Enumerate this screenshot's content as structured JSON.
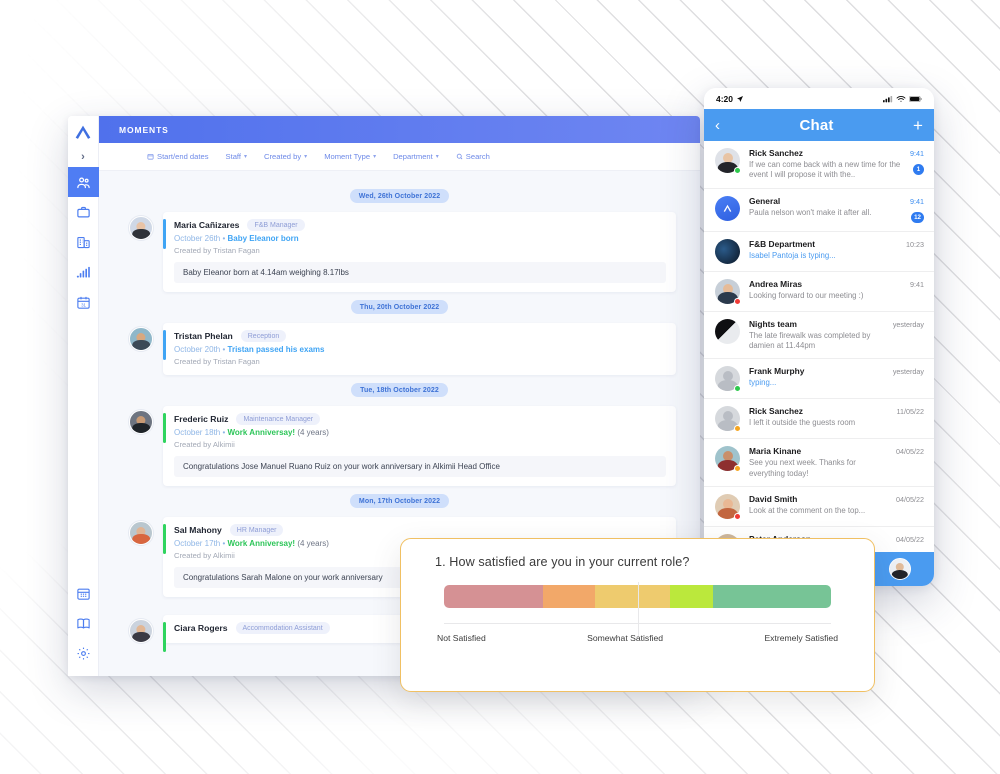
{
  "desktop": {
    "titlebar": {
      "title": "MOMENTS"
    },
    "rail": {
      "logo_icon": "alkimii-logo-icon",
      "expand_icon": "chevron-right-icon",
      "items": [
        {
          "name": "people",
          "icon": "people-icon",
          "active": true
        },
        {
          "name": "briefcase",
          "icon": "briefcase-icon",
          "active": false
        },
        {
          "name": "building",
          "icon": "building-icon",
          "active": false
        },
        {
          "name": "analytics",
          "icon": "bar-chart-icon",
          "active": false
        },
        {
          "name": "calendar",
          "icon": "calendar-31-icon",
          "active": false
        }
      ],
      "bottom_items": [
        {
          "name": "rota",
          "icon": "calendar-grid-icon"
        },
        {
          "name": "handbook",
          "icon": "book-icon"
        },
        {
          "name": "settings",
          "icon": "gear-icon"
        }
      ]
    },
    "filters": [
      {
        "label": "Start/end dates",
        "icon": "calendar-icon",
        "caret": false
      },
      {
        "label": "Staff",
        "icon": "",
        "caret": true
      },
      {
        "label": "Created by",
        "icon": "",
        "caret": true
      },
      {
        "label": "Moment Type",
        "icon": "",
        "caret": true
      },
      {
        "label": "Department",
        "icon": "",
        "caret": true
      },
      {
        "label": "Search",
        "icon": "search-icon",
        "caret": false
      }
    ],
    "feed": [
      {
        "date_label": "Wed, 26th October 2022",
        "name": "Maria Cañizares",
        "tag": "F&B Manager",
        "date": "October 26th",
        "event": "Baby Eleanor born",
        "event_suffix": "",
        "accent": "blue",
        "created_by": "Created by Tristan Fagan",
        "body": "Baby Eleanor born at 4.14am weighing 8.17lbs",
        "avatar_skin": "#e8c3a6",
        "avatar_shirt": "#2f3239",
        "avatar_bg": "#cfd8e6"
      },
      {
        "date_label": "Thu, 20th October 2022",
        "name": "Tristan Phelan",
        "tag": "Reception",
        "date": "October 20th",
        "event": "Tristan passed his exams",
        "event_suffix": "",
        "accent": "blue",
        "created_by": "Created by Tristan Fagan",
        "body": "",
        "avatar_skin": "#d9a87f",
        "avatar_shirt": "#3c4a57",
        "avatar_bg": "#8fb7c9"
      },
      {
        "date_label": "Tue, 18th October 2022",
        "name": "Frederic Ruiz",
        "tag": "Maintenance Manager",
        "date": "October 18th",
        "event": "Work Anniversay!",
        "event_suffix": "(4 years)",
        "accent": "green",
        "created_by": "Created by Alkimii",
        "body": "Congratulations Jose Manuel Ruano Ruiz on your work anniversary in Alkimii Head Office",
        "avatar_skin": "#c89a74",
        "avatar_shirt": "#1f2429",
        "avatar_bg": "#6d7480"
      },
      {
        "date_label": "Mon, 17th October 2022",
        "name": "Sal Mahony",
        "tag": "HR Manager",
        "date": "October 17th",
        "event": "Work Anniversay!",
        "event_suffix": "(4 years)",
        "accent": "green",
        "created_by": "Created by Alkimii",
        "body": "Congratulations Sarah Malone on your work anniversary",
        "avatar_skin": "#e0b494",
        "avatar_shirt": "#d8663f",
        "avatar_bg": "#b9c7cf"
      },
      {
        "date_label": "",
        "name": "Ciara Rogers",
        "tag": "Accommodation Assistant",
        "date": "",
        "event": "",
        "event_suffix": "",
        "accent": "green",
        "created_by": "",
        "body": "",
        "avatar_skin": "#e2b795",
        "avatar_shirt": "#3a3a44",
        "avatar_bg": "#cbd3de"
      }
    ]
  },
  "phone": {
    "status": {
      "time": "4:20",
      "location_icon": "location-arrow-icon",
      "signal_icon": "cellular-signal-icon",
      "wifi_icon": "wifi-icon",
      "battery_icon": "battery-icon"
    },
    "header": {
      "back_icon": "chevron-left-icon",
      "title": "Chat",
      "add_icon": "plus-icon"
    },
    "chats": [
      {
        "name": "Rick Sanchez",
        "preview": "If we can come back with a new time for the event I will propose it with the..",
        "time": "9:41",
        "time_blue": true,
        "badge": "1",
        "typing": false,
        "dot": "#2fc94e",
        "av_skin": "#e8c4a5",
        "av_shirt": "#23242a",
        "av_bg": "#dfe2e8",
        "av_photo": true
      },
      {
        "name": "General",
        "preview": "Paula nelson won't make it after all.",
        "time": "9:41",
        "time_blue": true,
        "badge": "12",
        "typing": false,
        "dot": "",
        "av_skin": "",
        "av_shirt": "",
        "av_bg": "#2f6df0",
        "av_logo": true
      },
      {
        "name": "F&B Department",
        "preview": "Isabel Pantoja is typing...",
        "time": "10:23",
        "time_blue": false,
        "badge": "",
        "typing": true,
        "dot": "",
        "av_skin": "#1b3048",
        "av_shirt": "#0d1a2b",
        "av_bg": "#14243a",
        "av_photo": true
      },
      {
        "name": "Andrea Miras",
        "preview": "Looking forward to our meeting :)",
        "time": "9:41",
        "time_blue": false,
        "badge": "",
        "typing": false,
        "dot": "#f03b36",
        "av_skin": "#e6bb98",
        "av_shirt": "#2b3a4c",
        "av_bg": "#c7cfd8",
        "av_photo": true
      },
      {
        "name": "Nights team",
        "preview": "The late firewalk was completed by damien at 11.44pm",
        "time": "yesterday",
        "time_blue": false,
        "badge": "",
        "typing": false,
        "dot": "",
        "av_skin": "#2a2a2e",
        "av_shirt": "#101013",
        "av_bg": "#e9ebee",
        "av_photo": true
      },
      {
        "name": "Frank Murphy",
        "preview": "typing...",
        "time": "yesterday",
        "time_blue": false,
        "badge": "",
        "typing": true,
        "dot": "#2fc94e",
        "av_skin": "",
        "av_shirt": "",
        "av_bg": "#d6d9dd",
        "av_placeholder": true
      },
      {
        "name": "Rick Sanchez",
        "preview": "I left it outside the guests room",
        "time": "11/05/22",
        "time_blue": false,
        "badge": "",
        "typing": false,
        "dot": "#f5a623",
        "av_skin": "",
        "av_shirt": "",
        "av_bg": "#d6d9dd",
        "av_placeholder": true
      },
      {
        "name": "Maria Kinane",
        "preview": "See you next week. Thanks for everything today!",
        "time": "04/05/22",
        "time_blue": false,
        "badge": "",
        "typing": false,
        "dot": "#f5a623",
        "av_skin": "#c98f6a",
        "av_shirt": "#8e2f2f",
        "av_bg": "#9fc3cc",
        "av_photo": true
      },
      {
        "name": "David Smith",
        "preview": "Look at the comment on the top...",
        "time": "04/05/22",
        "time_blue": false,
        "badge": "",
        "typing": false,
        "dot": "#f03b36",
        "av_skin": "#e9b894",
        "av_shirt": "#c2663f",
        "av_bg": "#e0ccb4",
        "av_photo": true
      },
      {
        "name": "Peter Anderson",
        "preview": "",
        "time": "04/05/22",
        "time_blue": false,
        "badge": "",
        "typing": false,
        "dot": "",
        "av_skin": "#d5a782",
        "av_shirt": "#3a3a40",
        "av_bg": "#cdb79c",
        "av_photo": true
      }
    ],
    "footer": {
      "avatar_name": "profile-avatar"
    }
  },
  "survey": {
    "question": "1. How satisfied are you in your current role?",
    "segments": [
      {
        "color": "#d59194",
        "width": 25.5
      },
      {
        "color": "#f2a869",
        "width": 13.5
      },
      {
        "color": "#eecb6e",
        "width": 11.5
      },
      {
        "color": "#eecb6e",
        "width": 8.0
      },
      {
        "color": "#bbe83c",
        "width": 11.0
      },
      {
        "color": "#77c496",
        "width": 30.5
      }
    ],
    "labels": {
      "left": "Not Satisfied",
      "center": "Somewhat Satisfied",
      "right": "Extremely Satisfied"
    }
  }
}
